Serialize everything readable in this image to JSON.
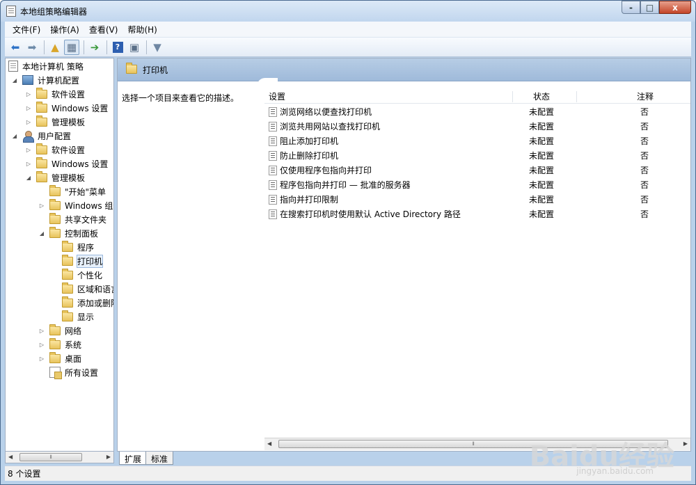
{
  "window": {
    "title": "本地组策略编辑器",
    "min_label": "-",
    "max_label": "□",
    "close_label": "x"
  },
  "menu": [
    "文件(F)",
    "操作(A)",
    "查看(V)",
    "帮助(H)"
  ],
  "toolbar": {
    "icons": [
      "back-arrow-icon",
      "forward-arrow-icon",
      "up-folder-icon",
      "show-tree-icon",
      "export-list-icon",
      "help-icon",
      "properties-icon",
      "filter-icon"
    ]
  },
  "tree": [
    {
      "label": "本地计算机 策略",
      "icon": "policy-doc-icon",
      "expander": ""
    },
    {
      "label": "计算机配置",
      "icon": "computer-icon",
      "expander": "◢"
    },
    {
      "label": "软件设置",
      "icon": "folder-icon",
      "expander": "▷"
    },
    {
      "label": "Windows 设置",
      "icon": "folder-icon",
      "expander": "▷"
    },
    {
      "label": "管理模板",
      "icon": "folder-icon",
      "expander": "▷"
    },
    {
      "label": "用户配置",
      "icon": "user-icon",
      "expander": "◢"
    },
    {
      "label": "软件设置",
      "icon": "folder-icon",
      "expander": "▷"
    },
    {
      "label": "Windows 设置",
      "icon": "folder-icon",
      "expander": "▷"
    },
    {
      "label": "管理模板",
      "icon": "folder-icon",
      "expander": "◢"
    },
    {
      "label": "\"开始\"菜单",
      "icon": "folder-icon",
      "expander": ""
    },
    {
      "label": "Windows 组件",
      "icon": "folder-icon",
      "expander": "▷"
    },
    {
      "label": "共享文件夹",
      "icon": "folder-icon",
      "expander": ""
    },
    {
      "label": "控制面板",
      "icon": "folder-icon",
      "expander": "◢"
    },
    {
      "label": "程序",
      "icon": "folder-icon",
      "expander": ""
    },
    {
      "label": "打印机",
      "icon": "folder-icon",
      "expander": ""
    },
    {
      "label": "个性化",
      "icon": "folder-icon",
      "expander": ""
    },
    {
      "label": "区域和语言",
      "icon": "folder-icon",
      "expander": ""
    },
    {
      "label": "添加或删除",
      "icon": "folder-icon",
      "expander": ""
    },
    {
      "label": "显示",
      "icon": "folder-icon",
      "expander": ""
    },
    {
      "label": "网络",
      "icon": "folder-icon",
      "expander": "▷"
    },
    {
      "label": "系统",
      "icon": "folder-icon",
      "expander": "▷"
    },
    {
      "label": "桌面",
      "icon": "folder-icon",
      "expander": "▷"
    },
    {
      "label": "所有设置",
      "icon": "all-settings-icon",
      "expander": ""
    }
  ],
  "right": {
    "header": "打印机",
    "description": "选择一个项目来查看它的描述。",
    "columns": {
      "setting": "设置",
      "state": "状态",
      "note": "注释"
    },
    "rows": [
      {
        "name": "浏览网络以便查找打印机",
        "state": "未配置",
        "note": "否"
      },
      {
        "name": "浏览共用网站以查找打印机",
        "state": "未配置",
        "note": "否"
      },
      {
        "name": "阻止添加打印机",
        "state": "未配置",
        "note": "否"
      },
      {
        "name": "防止删除打印机",
        "state": "未配置",
        "note": "否"
      },
      {
        "name": "仅使用程序包指向并打印",
        "state": "未配置",
        "note": "否"
      },
      {
        "name": "程序包指向并打印 — 批准的服务器",
        "state": "未配置",
        "note": "否"
      },
      {
        "name": "指向并打印限制",
        "state": "未配置",
        "note": "否"
      },
      {
        "name": "在搜索打印机时使用默认 Active Directory 路径",
        "state": "未配置",
        "note": "否"
      }
    ]
  },
  "tabs": [
    "扩展",
    "标准"
  ],
  "status": "8 个设置",
  "watermark": {
    "main": "Baidu经验",
    "sub": "jingyan.baidu.com"
  }
}
